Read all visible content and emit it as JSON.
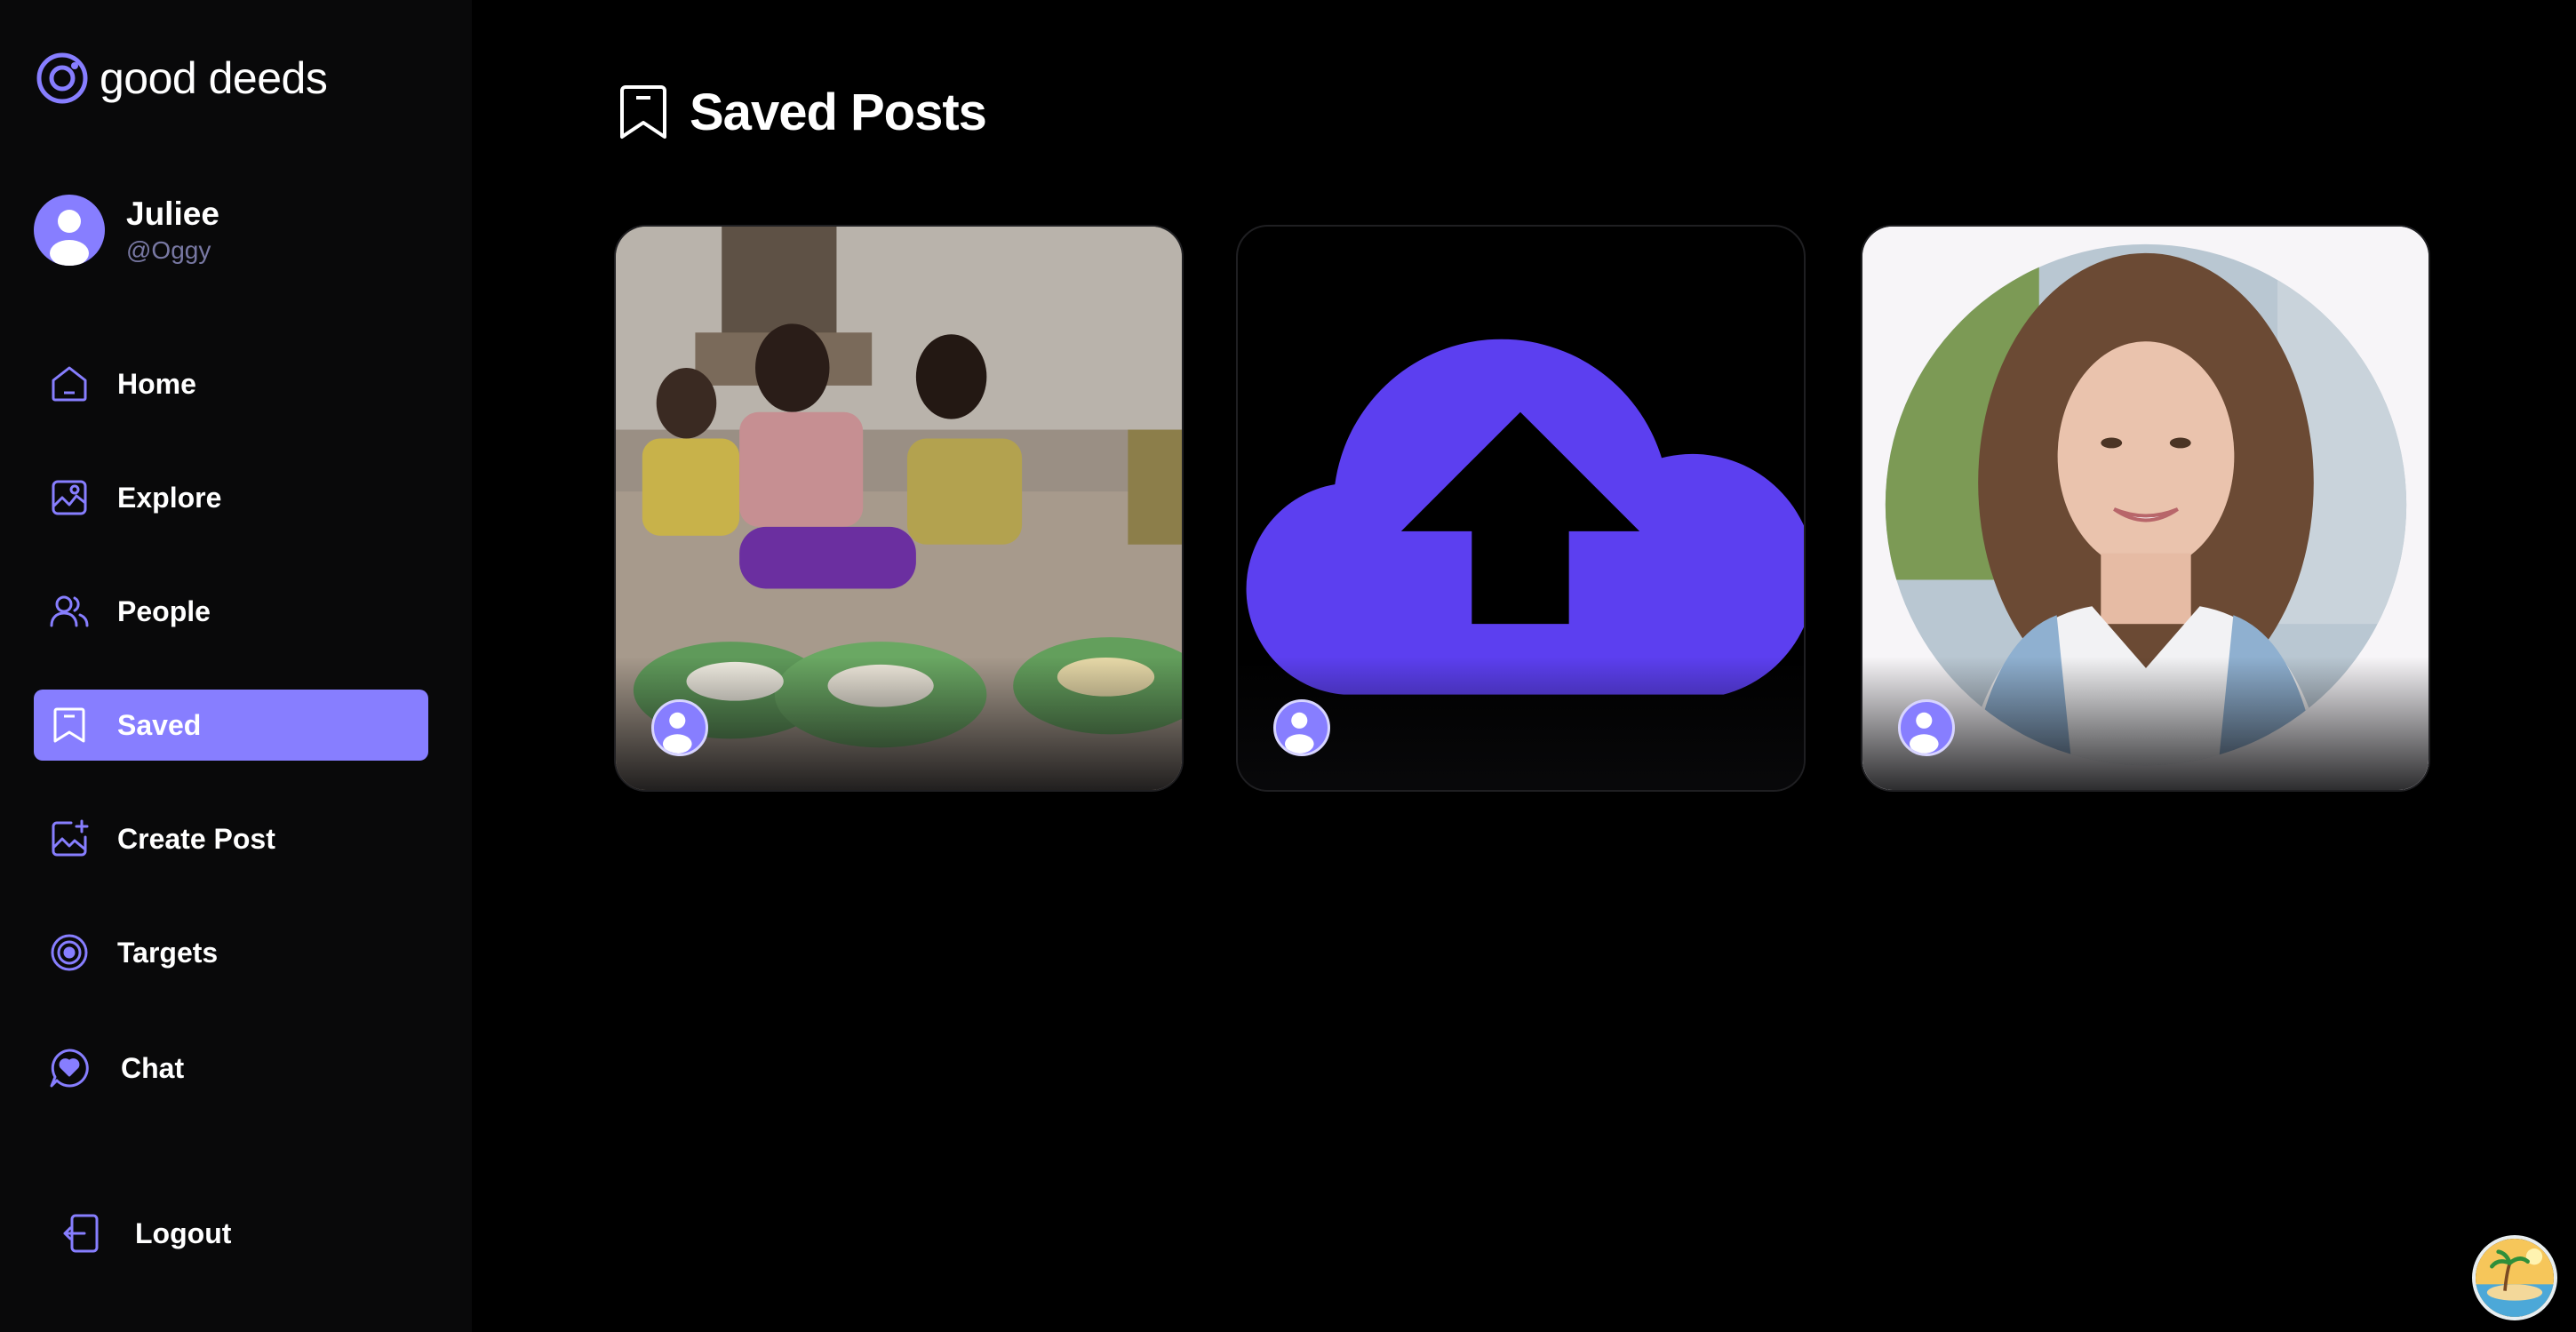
{
  "app": {
    "name": "good deeds"
  },
  "user": {
    "name": "Juliee",
    "handle": "@Oggy"
  },
  "nav": {
    "items": [
      {
        "label": "Home",
        "icon": "home-icon",
        "active": false
      },
      {
        "label": "Explore",
        "icon": "explore-icon",
        "active": false
      },
      {
        "label": "People",
        "icon": "people-icon",
        "active": false
      },
      {
        "label": "Saved",
        "icon": "bookmark-icon",
        "active": true
      },
      {
        "label": "Create Post",
        "icon": "create-post-icon",
        "active": false
      },
      {
        "label": "Targets",
        "icon": "target-icon",
        "active": false
      },
      {
        "label": "Chat",
        "icon": "chat-icon",
        "active": false
      }
    ],
    "logout_label": "Logout"
  },
  "page": {
    "title": "Saved Posts"
  },
  "posts": [
    {
      "image": "children-eating-photo"
    },
    {
      "image": "cloud-upload-image"
    },
    {
      "image": "smiling-woman-portrait"
    }
  ],
  "colors": {
    "accent": "#877eff",
    "sidebar_bg": "#09090a",
    "page_bg": "#000000",
    "upload_purple": "#5c3ff0"
  }
}
